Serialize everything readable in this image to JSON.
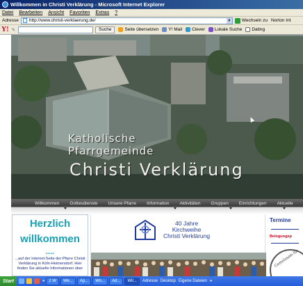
{
  "window": {
    "title": "Willkommen in Christi Verklärung - Microsoft Internet Explorer"
  },
  "menu": [
    "Datei",
    "Bearbeiten",
    "Ansicht",
    "Favoriten",
    "Extras",
    "?"
  ],
  "address_bar": {
    "label": "Adresse",
    "url": "http://www.christi-verklaerung.de/",
    "go_label": "Wechseln zu",
    "links_label": "Norton Int"
  },
  "yahoo_toolbar": {
    "search_label": "Suche",
    "items": [
      "Seite übersetzen",
      "Y! Mail",
      "Clever",
      "Lokale Suche",
      "Dating"
    ]
  },
  "hero": {
    "line1": "Katholische",
    "line2": "Pfarrgemeinde",
    "line3": "Christi Verklärung"
  },
  "nav": [
    "Willkommen",
    "Gottesdienste",
    "Unsere Pfarre",
    "Information",
    "Aktivitäten",
    "Gruppen",
    "Einrichtungen",
    "Aktuelle"
  ],
  "welcome": {
    "line1": "Herzlich",
    "line2": "willkommen",
    "dots": "....",
    "intro": "...auf der Internet-Seite der Pfarre Christi Verklärung in Köln-Heimersdorf. Hier finden Sie aktuelle Informationen über"
  },
  "anniversary": {
    "line1": "40 Jahre",
    "line2": "Kirchweihe",
    "line3": "Christi Verklärung"
  },
  "sidebar": {
    "termine": "Termine",
    "belegung": "Belegungsp",
    "seal": "Gemeinsam für"
  },
  "taskbar": {
    "start": "Start",
    "buttons": [
      "2 W",
      "We...",
      "Ap...",
      "Wo...",
      "Ad...",
      "Wil..."
    ],
    "tray": [
      "Adresse",
      "Desktop",
      "Eigene Dateien"
    ],
    "chevron": "»"
  },
  "colors": {
    "welcome": "#18a0b4",
    "navy": "#1f3a9a",
    "red": "#d0021b",
    "titlebar": "#0a246a"
  }
}
